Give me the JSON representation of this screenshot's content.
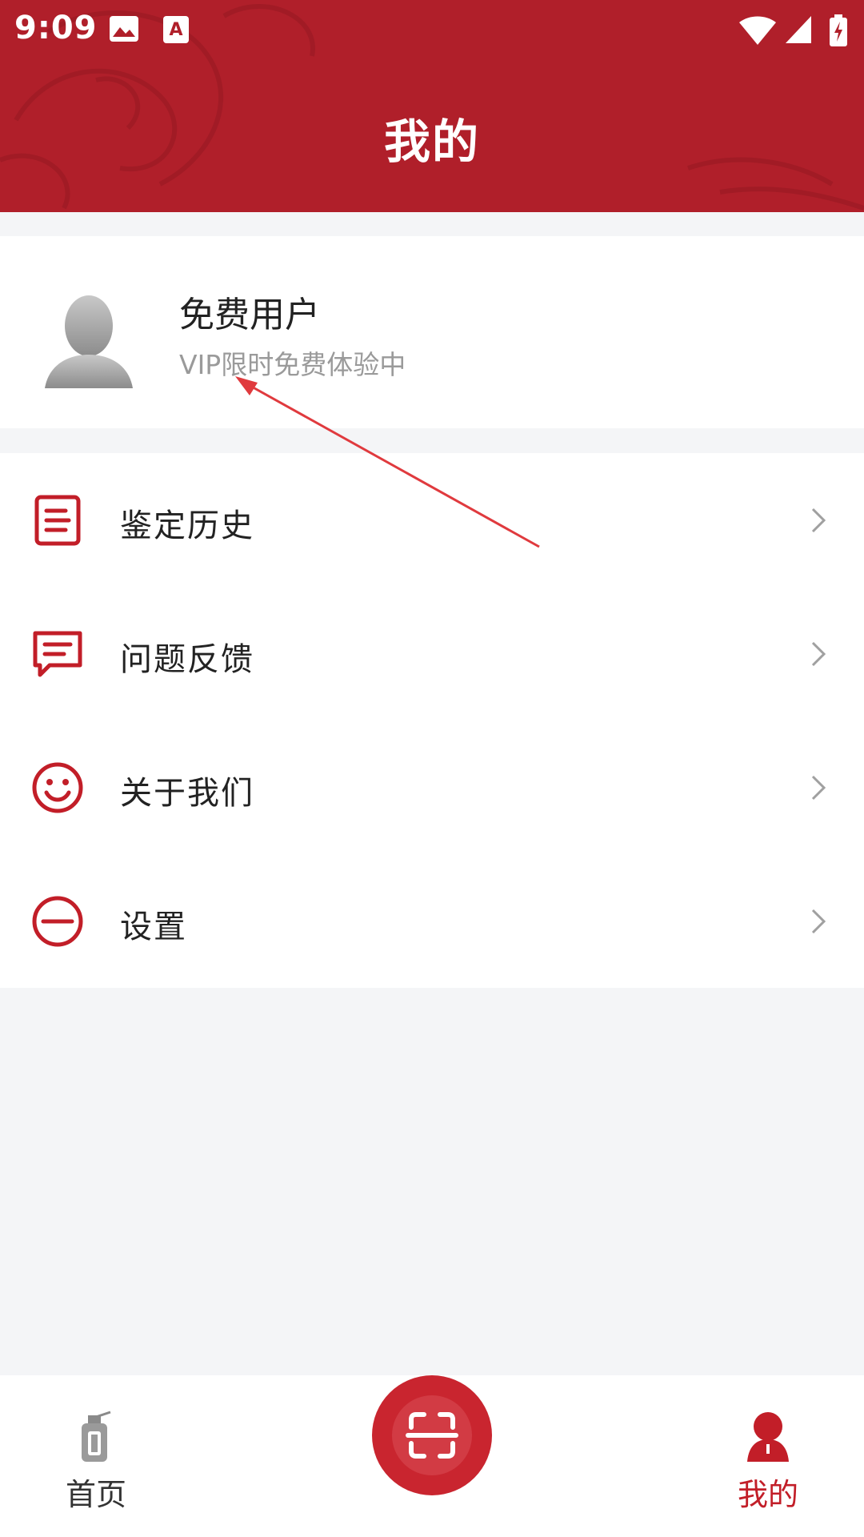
{
  "status_bar": {
    "time": "9:09",
    "icons": [
      "image-icon",
      "font-a-icon",
      "wifi-icon",
      "signal-icon",
      "battery-charging-icon"
    ]
  },
  "header": {
    "title": "我的"
  },
  "profile": {
    "name": "免费用户",
    "status": "VIP限时免费体验中",
    "avatar_icon": "default-avatar-icon"
  },
  "menu": {
    "items": [
      {
        "label": "鉴定历史",
        "icon": "document-icon"
      },
      {
        "label": "问题反馈",
        "icon": "chat-bubble-icon"
      },
      {
        "label": "关于我们",
        "icon": "smiley-icon"
      },
      {
        "label": "设置",
        "icon": "minus-circle-icon"
      }
    ]
  },
  "tabbar": {
    "home_label": "首页",
    "mine_label": "我的",
    "scan_icon": "scan-icon"
  },
  "colors": {
    "brand_red": "#b01f2a",
    "accent_red": "#c9252f",
    "active_tab": "#c21e28",
    "inactive_tab": "#333333",
    "background": "#f4f5f7"
  }
}
